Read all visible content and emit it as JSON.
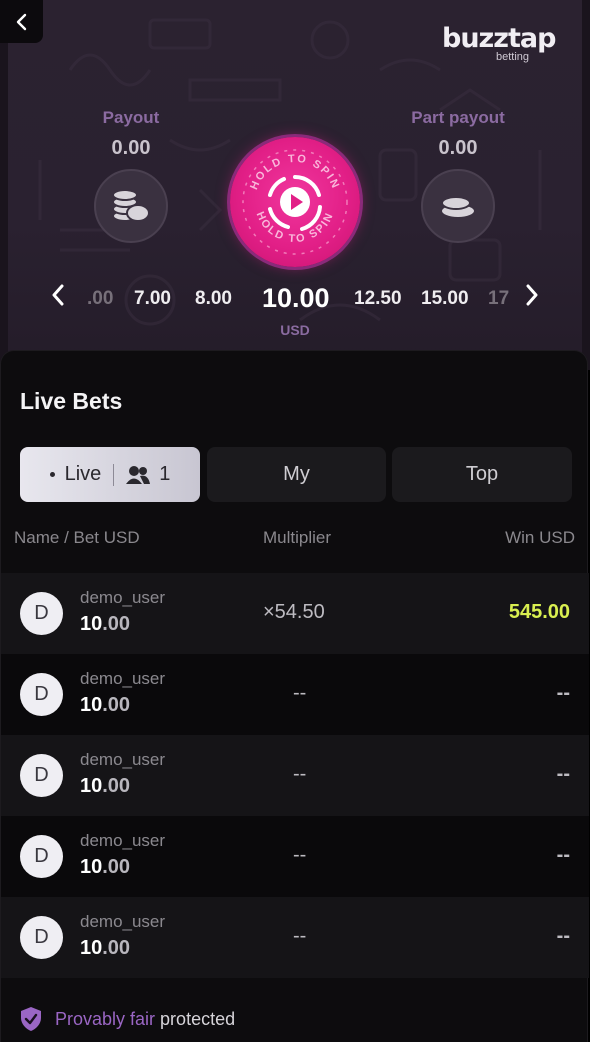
{
  "header": {
    "brand": "buzztap",
    "brand_sub": "betting"
  },
  "payout": {
    "label": "Payout",
    "value": "0.00"
  },
  "part_payout": {
    "label": "Part payout",
    "value": "0.00"
  },
  "spin_button": {
    "text": "HOLD TO SPIN"
  },
  "bet_selector": {
    "values": [
      ".00",
      "7.00",
      "8.00",
      "10.00",
      "12.50",
      "15.00",
      "17"
    ],
    "selected": "10.00",
    "currency": "USD"
  },
  "live_bets": {
    "title": "Live Bets",
    "tabs": {
      "live": "Live",
      "live_count": "1",
      "my": "My",
      "top": "Top"
    },
    "columns": {
      "name_bet": "Name / Bet USD",
      "multiplier": "Multiplier",
      "win": "Win USD"
    },
    "rows": [
      {
        "avatar": "D",
        "user": "demo_user",
        "amount_int": "10",
        "amount_dec": ".00",
        "multiplier": "×54.50",
        "win": "545.00"
      },
      {
        "avatar": "D",
        "user": "demo_user",
        "amount_int": "10",
        "amount_dec": ".00",
        "multiplier": "--",
        "win": "--"
      },
      {
        "avatar": "D",
        "user": "demo_user",
        "amount_int": "10",
        "amount_dec": ".00",
        "multiplier": "--",
        "win": "--"
      },
      {
        "avatar": "D",
        "user": "demo_user",
        "amount_int": "10",
        "amount_dec": ".00",
        "multiplier": "--",
        "win": "--"
      },
      {
        "avatar": "D",
        "user": "demo_user",
        "amount_int": "10",
        "amount_dec": ".00",
        "multiplier": "--",
        "win": "--"
      }
    ]
  },
  "footer": {
    "fair": "Provably fair",
    "protected": "protected"
  },
  "colors": {
    "accent": "#e21f87",
    "win": "#d9ef50",
    "label_purple": "#8b6ba1"
  },
  "icons": [
    "back-arrow-icon",
    "coins-stack-icon",
    "coin-icon",
    "play-icon",
    "chevron-left-icon",
    "chevron-right-icon",
    "users-icon",
    "shield-check-icon"
  ]
}
